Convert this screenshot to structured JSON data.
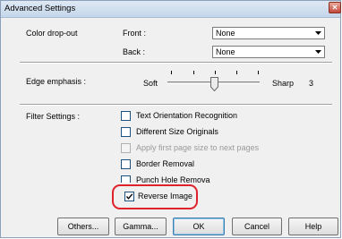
{
  "window": {
    "title": "Advanced Settings",
    "close_glyph": "✕"
  },
  "color_dropout": {
    "label": "Color drop-out",
    "front_label": "Front :",
    "front_value": "None",
    "back_label": "Back :",
    "back_value": "None"
  },
  "edge_emphasis": {
    "label": "Edge emphasis :",
    "min_label": "Soft",
    "max_label": "Sharp",
    "value": "3",
    "level": 3,
    "max": 4
  },
  "filter_settings": {
    "label": "Filter Settings :",
    "options": [
      {
        "label": "Text Orientation Recognition",
        "checked": false,
        "disabled": false
      },
      {
        "label": "Different Size Originals",
        "checked": false,
        "disabled": false
      },
      {
        "label": "Apply first page size to next pages",
        "checked": false,
        "disabled": true
      },
      {
        "label": "Border Removal",
        "checked": false,
        "disabled": false
      },
      {
        "label": "Punch Hole Removal",
        "checked": false,
        "disabled": false
      },
      {
        "label": "Reverse Image",
        "checked": true,
        "disabled": false
      }
    ]
  },
  "buttons": {
    "others": "Others...",
    "gamma": "Gamma...",
    "ok": "OK",
    "cancel": "Cancel",
    "help": "Help"
  },
  "colors": {
    "highlight": "#e0202a",
    "titlebar": "#c5d6ea"
  }
}
